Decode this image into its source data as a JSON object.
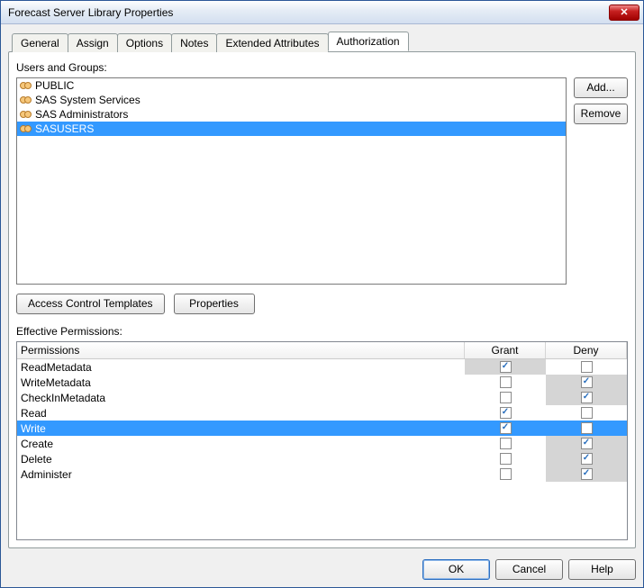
{
  "window": {
    "title": "Forecast Server Library Properties"
  },
  "tabs": [
    "General",
    "Assign",
    "Options",
    "Notes",
    "Extended Attributes",
    "Authorization"
  ],
  "active_tab": 5,
  "labels": {
    "users_groups": "Users and Groups:",
    "effective_permissions": "Effective Permissions:"
  },
  "users_groups": {
    "items": [
      {
        "name": "PUBLIC",
        "selected": false
      },
      {
        "name": "SAS System Services",
        "selected": false
      },
      {
        "name": "SAS Administrators",
        "selected": false
      },
      {
        "name": "SASUSERS",
        "selected": true
      }
    ]
  },
  "side_buttons": {
    "add": "Add...",
    "remove": "Remove"
  },
  "mid_buttons": {
    "act": "Access Control Templates",
    "props": "Properties"
  },
  "perm_headers": {
    "permissions": "Permissions",
    "grant": "Grant",
    "deny": "Deny"
  },
  "permissions": [
    {
      "name": "ReadMetadata",
      "grant": true,
      "grant_shaded": true,
      "deny": false,
      "deny_shaded": false,
      "selected": false
    },
    {
      "name": "WriteMetadata",
      "grant": false,
      "grant_shaded": false,
      "deny": true,
      "deny_shaded": true,
      "selected": false
    },
    {
      "name": "CheckInMetadata",
      "grant": false,
      "grant_shaded": false,
      "deny": true,
      "deny_shaded": true,
      "selected": false
    },
    {
      "name": "Read",
      "grant": true,
      "grant_shaded": false,
      "deny": false,
      "deny_shaded": false,
      "selected": false
    },
    {
      "name": "Write",
      "grant": true,
      "grant_shaded": false,
      "deny": false,
      "deny_shaded": false,
      "selected": true
    },
    {
      "name": "Create",
      "grant": false,
      "grant_shaded": false,
      "deny": true,
      "deny_shaded": true,
      "selected": false
    },
    {
      "name": "Delete",
      "grant": false,
      "grant_shaded": false,
      "deny": true,
      "deny_shaded": true,
      "selected": false
    },
    {
      "name": "Administer",
      "grant": false,
      "grant_shaded": false,
      "deny": true,
      "deny_shaded": true,
      "selected": false
    }
  ],
  "footer": {
    "ok": "OK",
    "cancel": "Cancel",
    "help": "Help"
  }
}
